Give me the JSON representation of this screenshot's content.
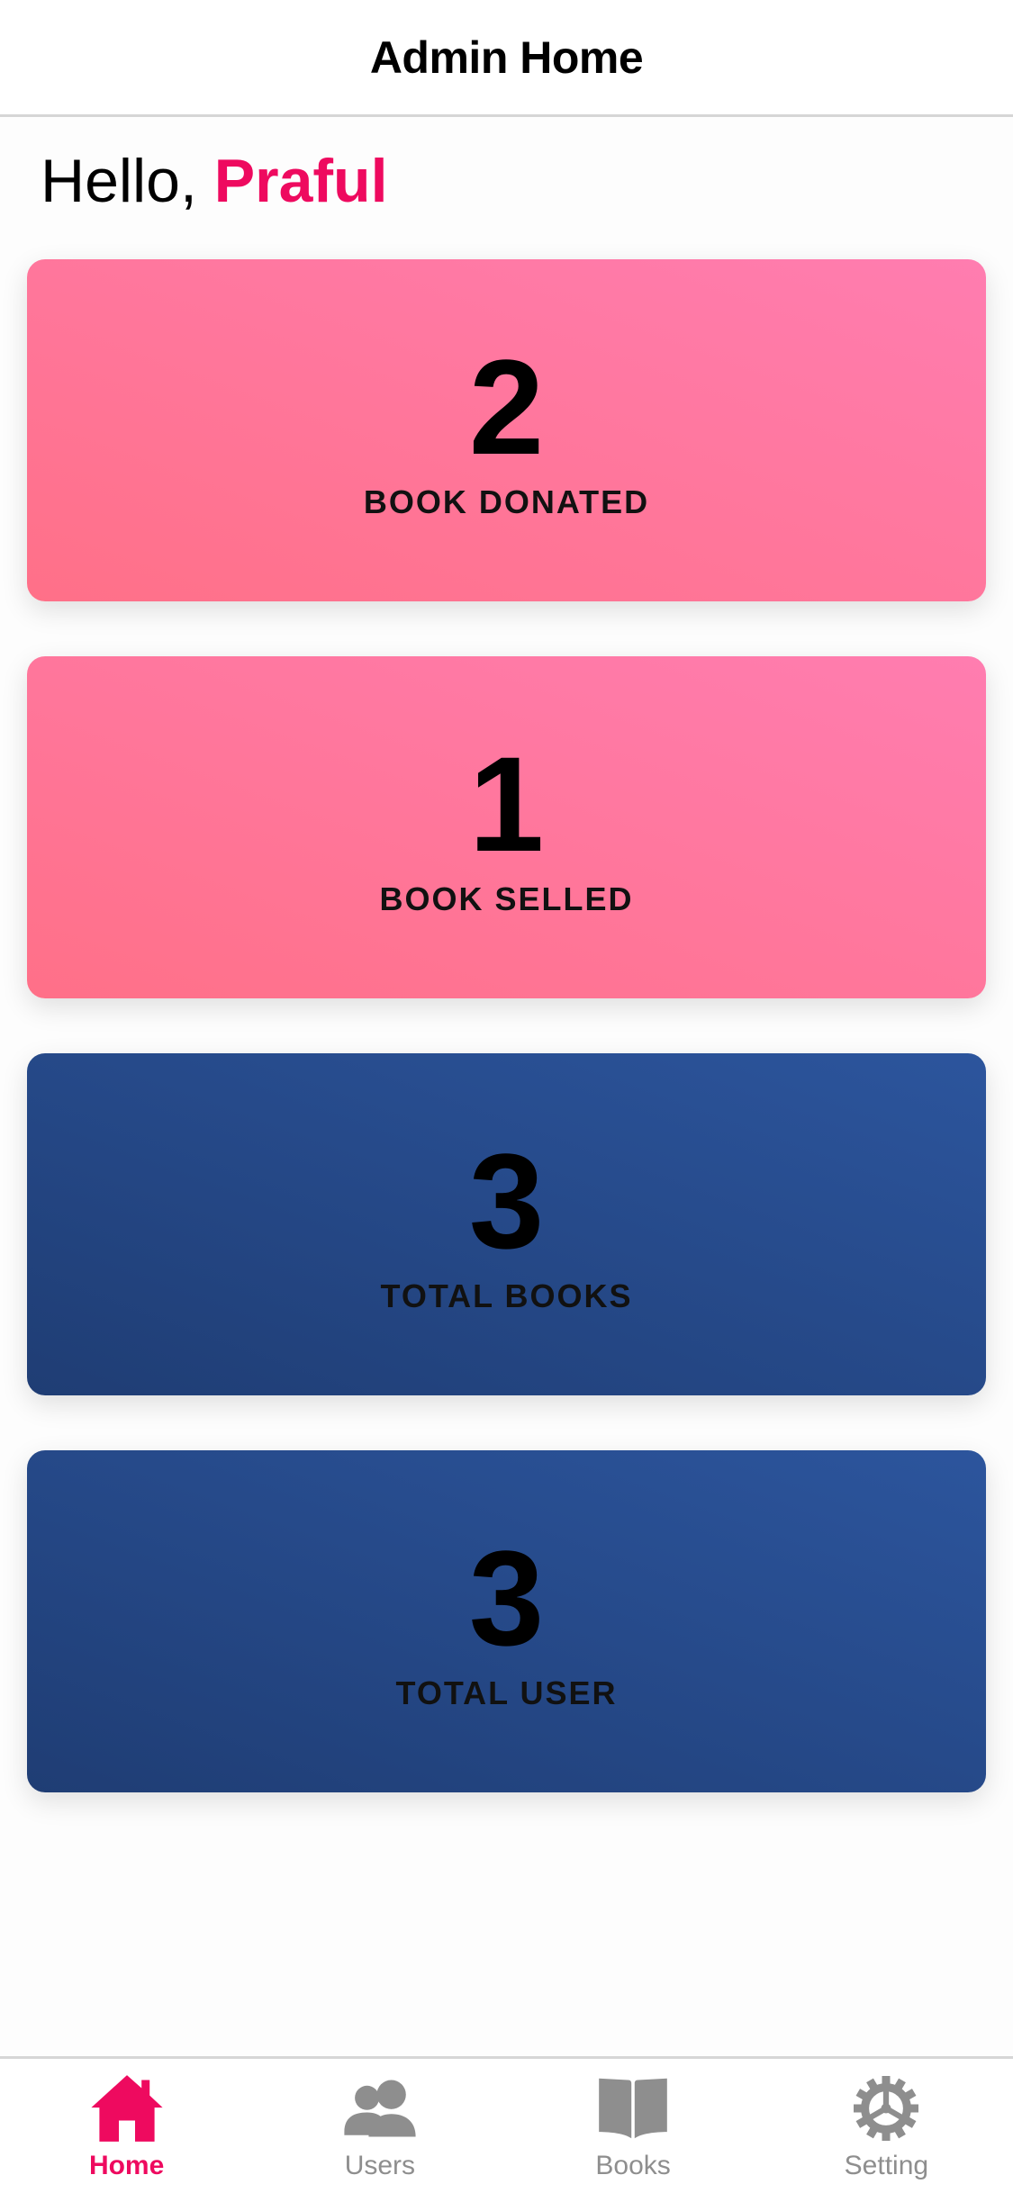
{
  "header": {
    "title": "Admin Home"
  },
  "greeting": {
    "prefix": "Hello, ",
    "name": "Praful"
  },
  "cards": [
    {
      "value": "2",
      "label": "BOOK DONATED"
    },
    {
      "value": "1",
      "label": "BOOK SELLED"
    },
    {
      "value": "3",
      "label": "TOTAL BOOKS"
    },
    {
      "value": "3",
      "label": "TOTAL USER"
    }
  ],
  "tabs": [
    {
      "label": "Home",
      "icon": "home-icon",
      "active": true
    },
    {
      "label": "Users",
      "icon": "users-icon",
      "active": false
    },
    {
      "label": "Books",
      "icon": "book-icon",
      "active": false
    },
    {
      "label": "Setting",
      "icon": "gear-icon",
      "active": false
    }
  ],
  "colors": {
    "accent": "#ee0a5f",
    "inactive": "#8e8e8e",
    "pink_start": "#ff7088",
    "pink_end": "#ff7db0",
    "blue_start": "#1f3d74",
    "blue_end": "#2c559d"
  }
}
